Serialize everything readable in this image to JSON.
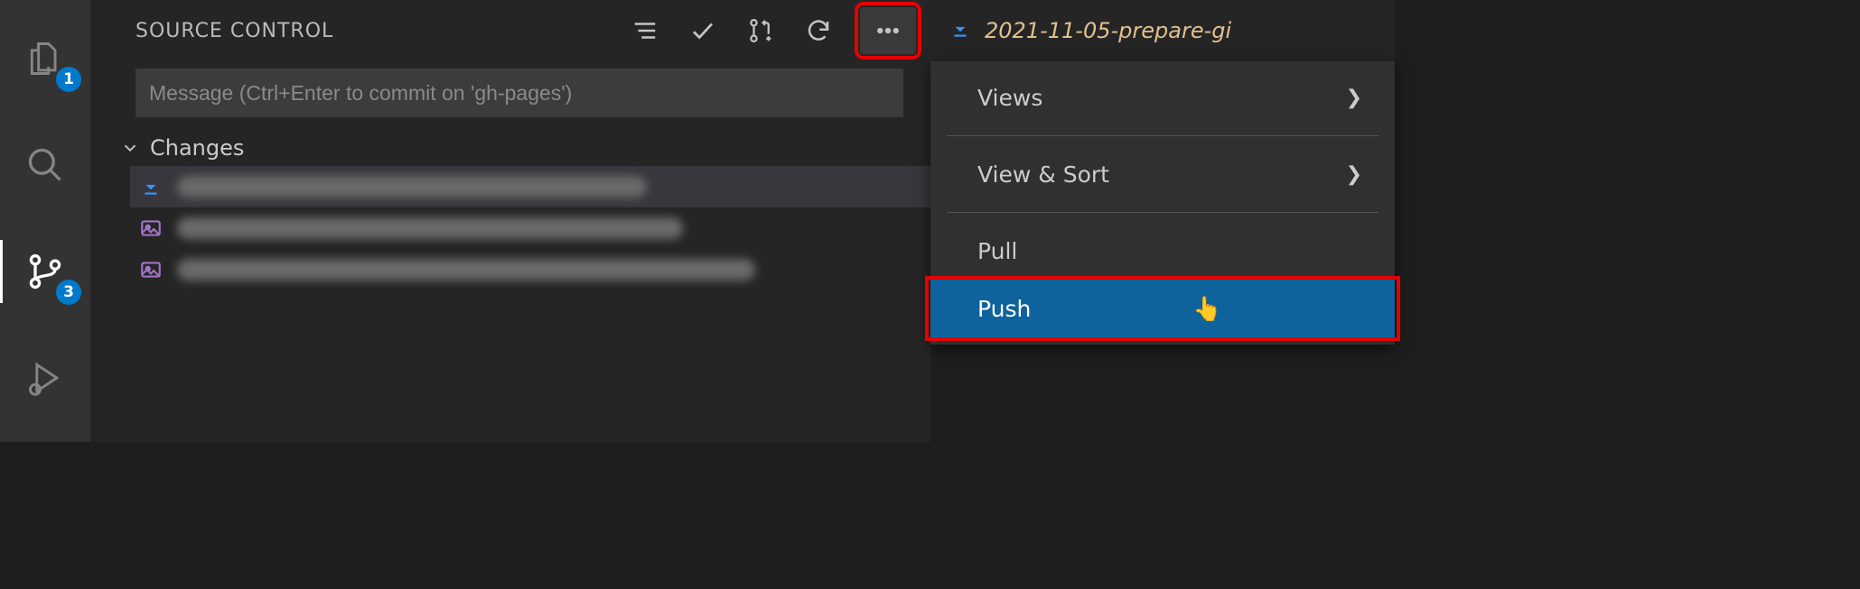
{
  "activity_bar": {
    "explorer_badge": "1",
    "scm_badge": "3"
  },
  "panel": {
    "title": "SOURCE CONTROL",
    "commit_placeholder": "Message (Ctrl+Enter to commit on 'gh-pages')",
    "section_changes": "Changes"
  },
  "tab": {
    "label": "2021-11-05-prepare-gi"
  },
  "menu": {
    "views": "Views",
    "view_sort": "View & Sort",
    "pull": "Pull",
    "push": "Push"
  }
}
